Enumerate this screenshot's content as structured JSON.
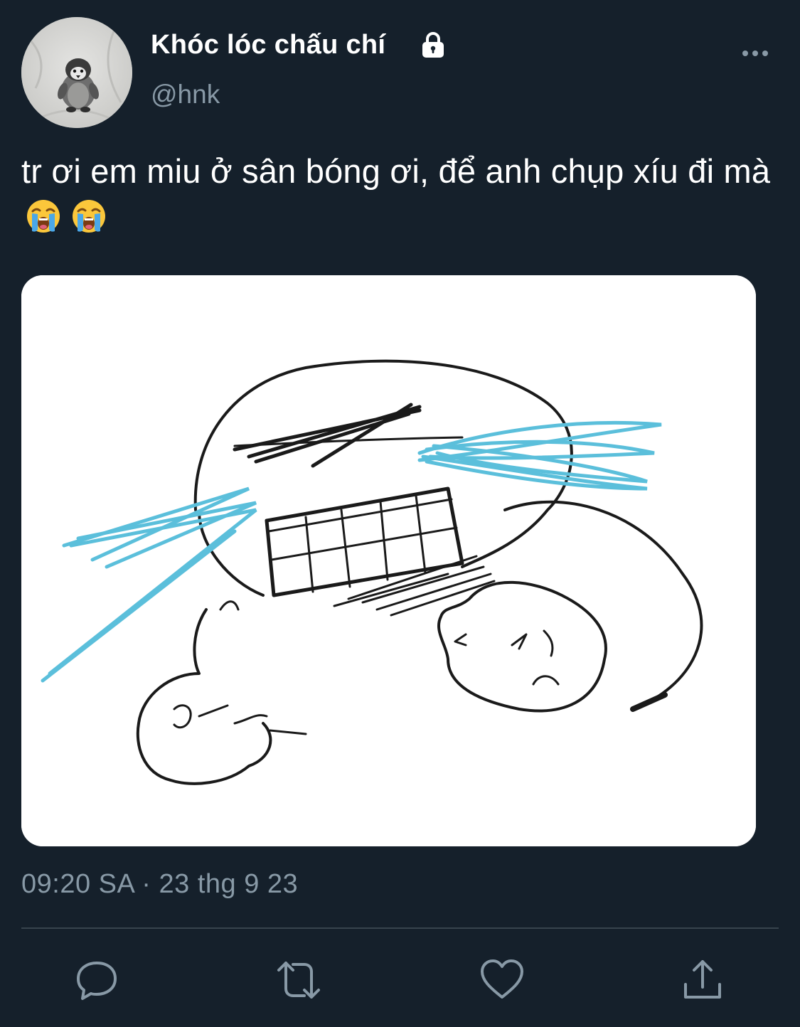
{
  "user": {
    "display_name": "Khóc lóc chấu chí",
    "handle": "@hnk",
    "protected_icon": "lock-icon",
    "avatar_icon": "penguin-plush-avatar"
  },
  "tweet": {
    "text_main": "tr ơi em miu ở sân bóng ơi, để anh chụp xíu đi mà",
    "emojis": [
      "loudly-crying-face",
      "loudly-crying-face"
    ],
    "media_icon": "crying-meme-drawing",
    "timestamp": "09:20 SA · 23 thg 9 23"
  },
  "actions": [
    {
      "name": "reply",
      "icon": "reply-icon"
    },
    {
      "name": "retweet",
      "icon": "retweet-icon"
    },
    {
      "name": "like",
      "icon": "heart-icon"
    },
    {
      "name": "share",
      "icon": "share-icon"
    }
  ],
  "colors": {
    "background": "#15202b",
    "text": "#ffffff",
    "secondary_text": "#8899a6",
    "divider": "#38444d",
    "icon": "#8899a6",
    "tear_blue": "#5bbfdb"
  }
}
